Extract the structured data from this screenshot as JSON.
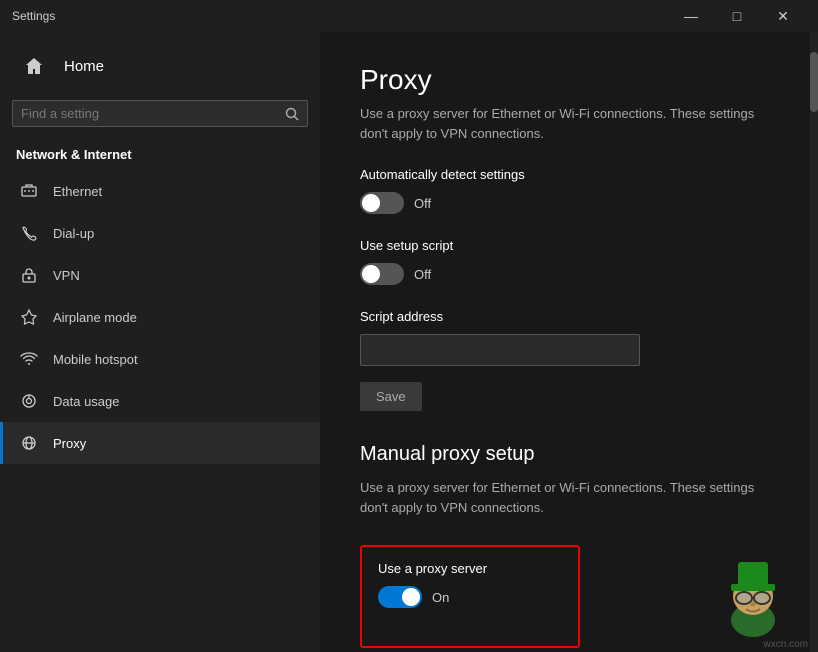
{
  "titlebar": {
    "title": "Settings",
    "minimize": "—",
    "maximize": "□",
    "close": "✕"
  },
  "sidebar": {
    "home_label": "Home",
    "search_placeholder": "Find a setting",
    "section_label": "Network & Internet",
    "items": [
      {
        "id": "ethernet",
        "label": "Ethernet",
        "icon": "🖧"
      },
      {
        "id": "dialup",
        "label": "Dial-up",
        "icon": "📞"
      },
      {
        "id": "vpn",
        "label": "VPN",
        "icon": "🔒"
      },
      {
        "id": "airplane",
        "label": "Airplane mode",
        "icon": "✈"
      },
      {
        "id": "hotspot",
        "label": "Mobile hotspot",
        "icon": "📶"
      },
      {
        "id": "datausage",
        "label": "Data usage",
        "icon": "⊙"
      },
      {
        "id": "proxy",
        "label": "Proxy",
        "icon": "🌐"
      }
    ]
  },
  "content": {
    "page_title": "Proxy",
    "auto_section": {
      "desc": "Use a proxy server for Ethernet or Wi-Fi connections. These settings don't apply to VPN connections.",
      "auto_detect_label": "Automatically detect settings",
      "auto_detect_state": "Off",
      "use_script_label": "Use setup script",
      "use_script_state": "Off",
      "script_address_label": "Script address",
      "script_address_placeholder": "",
      "save_label": "Save"
    },
    "manual_section": {
      "title": "Manual proxy setup",
      "desc": "Use a proxy server for Ethernet or Wi-Fi connections. These settings don't apply to VPN connections.",
      "use_proxy_label": "Use a proxy server",
      "use_proxy_state": "On"
    }
  },
  "watermark": "wxcn.com"
}
